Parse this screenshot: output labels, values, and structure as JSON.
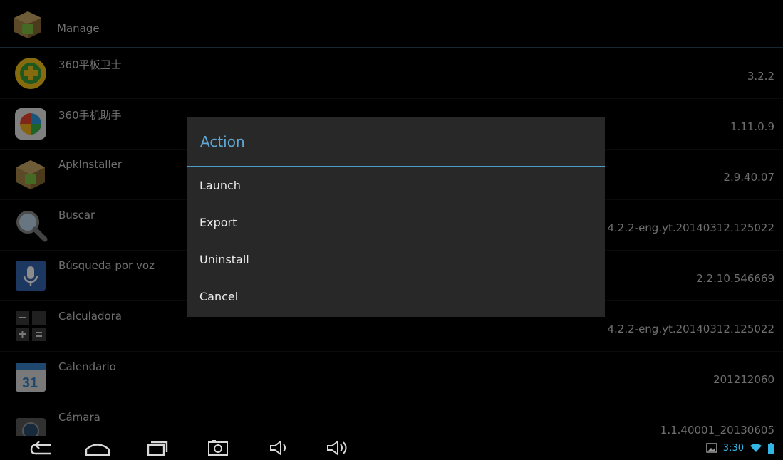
{
  "action_bar": {
    "title": "Manage",
    "icon": "apk-installer-box-icon"
  },
  "apps": [
    {
      "name": "360平板卫士",
      "version": "3.2.2",
      "icon": "360-security-icon"
    },
    {
      "name": "360手机助手",
      "version": "1.11.0.9",
      "icon": "360-assistant-icon"
    },
    {
      "name": "ApkInstaller",
      "version": "2.9.40.07",
      "icon": "apk-installer-icon"
    },
    {
      "name": "Buscar",
      "version": "4.2.2-eng.yt.20140312.125022",
      "icon": "search-magnifier-icon"
    },
    {
      "name": "Búsqueda por voz",
      "version": "2.2.10.546669",
      "icon": "voice-search-mic-icon"
    },
    {
      "name": "Calculadora",
      "version": "4.2.2-eng.yt.20140312.125022",
      "icon": "calculator-icon"
    },
    {
      "name": "Calendario",
      "version": "201212060",
      "icon": "calendar-icon"
    },
    {
      "name": "Cámara",
      "version": "1.1.40001_20130605",
      "icon": "camera-icon"
    }
  ],
  "dialog": {
    "title": "Action",
    "items": [
      "Launch",
      "Export",
      "Uninstall",
      "Cancel"
    ]
  },
  "status_bar": {
    "time": "3:30"
  },
  "colors": {
    "accent": "#33b5e5",
    "dialog_bg": "#282828",
    "dialog_title": "#5fa8d3"
  }
}
